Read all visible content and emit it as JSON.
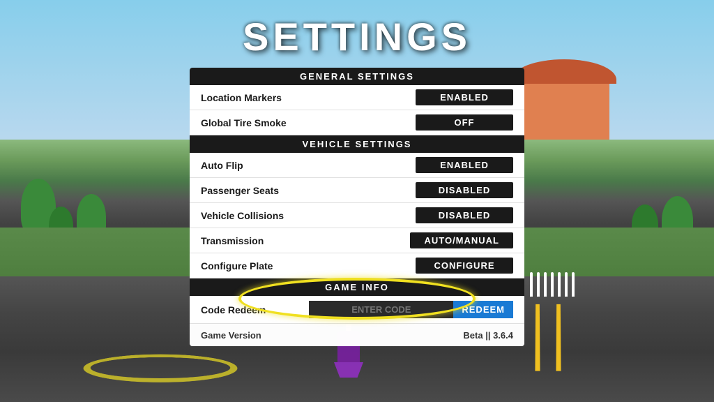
{
  "page": {
    "title": "SETTINGS",
    "background_colors": {
      "sky": "#87ceeb",
      "road": "#4a4a3a"
    }
  },
  "sections": {
    "general": {
      "header": "GENERAL SETTINGS",
      "rows": [
        {
          "label": "Location Markers",
          "value": "ENABLED"
        },
        {
          "label": "Global Tire Smoke",
          "value": "OFF"
        }
      ]
    },
    "vehicle": {
      "header": "VEHICLE SETTINGS",
      "rows": [
        {
          "label": "Auto Flip",
          "value": "ENABLED"
        },
        {
          "label": "Passenger Seats",
          "value": "DISABLED"
        },
        {
          "label": "Vehicle Collisions",
          "value": "DISABLED"
        },
        {
          "label": "Transmission",
          "value": "AUTO/MANUAL"
        },
        {
          "label": "Configure Plate",
          "value": "CONFIGURE"
        }
      ]
    },
    "game_info": {
      "header": "GAME INFO",
      "code_redeem": {
        "label": "Code Redeem",
        "input_placeholder": "ENTER CODE",
        "button_label": "REDEEM"
      },
      "game_version": {
        "label": "Game Version",
        "value": "Beta || 3.6.4"
      }
    }
  }
}
